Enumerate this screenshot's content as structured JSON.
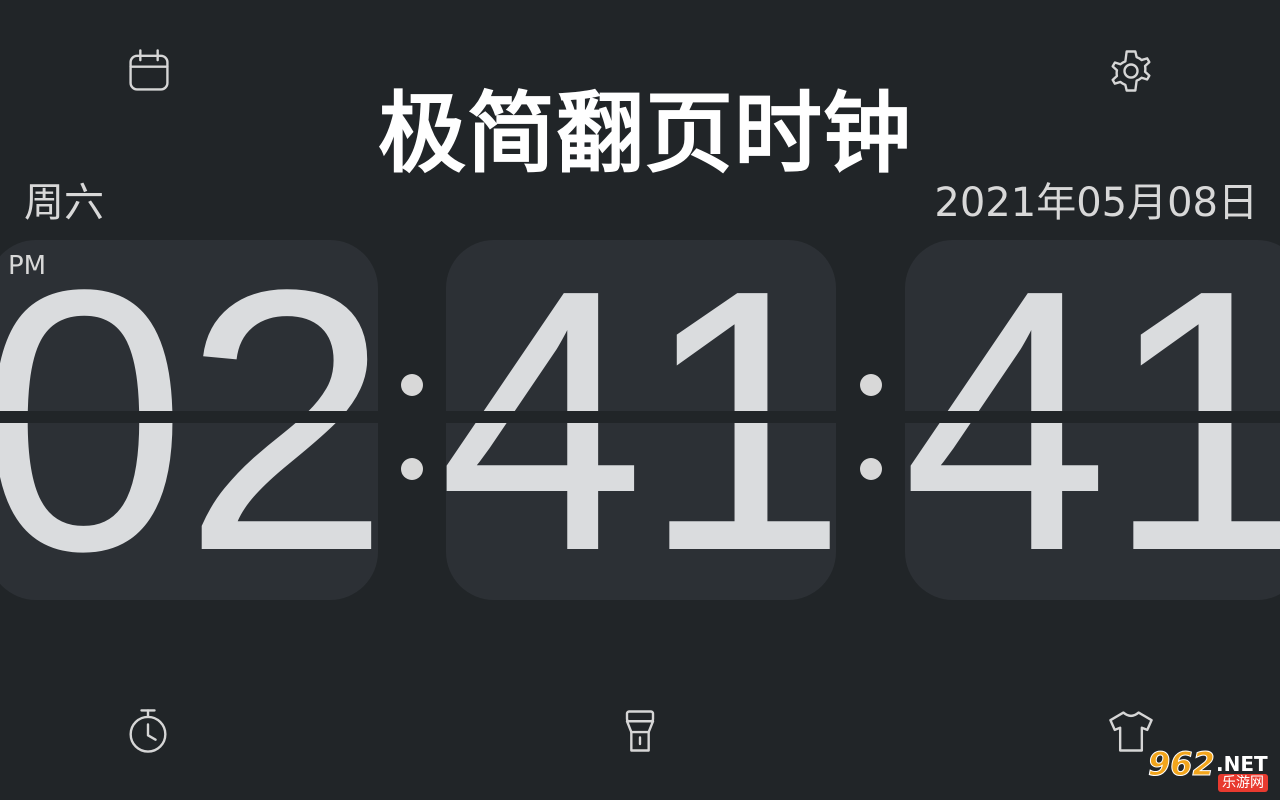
{
  "app": {
    "title": "极简翻页时钟"
  },
  "top_bar": {
    "left_icon": "calendar-icon",
    "right_icon": "gear-icon"
  },
  "info": {
    "weekday": "周六",
    "date": "2021年05月08日",
    "ampm": "PM"
  },
  "clock": {
    "hours": "02",
    "minutes": "41",
    "seconds": "41"
  },
  "bottom_bar": {
    "left_icon": "stopwatch-icon",
    "center_icon": "flashlight-icon",
    "right_icon": "tshirt-icon"
  },
  "watermark": {
    "number": "962",
    "suffix": ".NET",
    "label": "乐游网"
  },
  "colors": {
    "background": "#212528",
    "card": "#2c3035",
    "digit": "#dadcde",
    "text": "#d8d8d8",
    "title": "#ffffff"
  }
}
